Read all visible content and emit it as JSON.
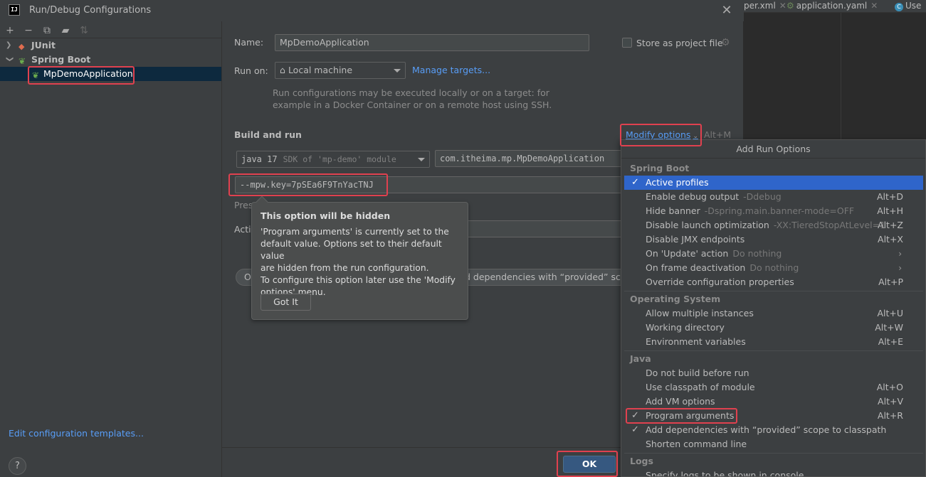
{
  "window": {
    "title": "Run/Debug Configurations",
    "app_icon": "IJ"
  },
  "editor": {
    "tabs": [
      {
        "label": "per.xml"
      },
      {
        "label": "application.yaml"
      },
      {
        "label": "Use"
      }
    ]
  },
  "tree": {
    "items": [
      {
        "label": "JUnit"
      },
      {
        "label": "Spring Boot"
      },
      {
        "label": "MpDemoApplication"
      }
    ]
  },
  "left_footer": {
    "edit_templates": "Edit configuration templates...",
    "help": "?"
  },
  "form": {
    "name_label": "Name:",
    "name_value": "MpDemoApplication",
    "store_label": "Store as project file",
    "run_on_label": "Run on:",
    "run_on_value": "Local machine",
    "manage_targets": "Manage targets...",
    "hint_line1": "Run configurations may be executed locally or on a target: for",
    "hint_line2": "example in a Docker Container or on a remote host using SSH.",
    "build_run": "Build and run",
    "modify_options": "Modify options",
    "modify_shortcut": "Alt+M",
    "jdk_version": "java 17",
    "jdk_hint": "SDK of 'mp-demo' module",
    "main_class": "com.itheima.mp.MpDemoApplication",
    "program_args": "--mpw.key=7pSEa6F9TnYacTNJ",
    "press_partial": "Pres",
    "active_partial": "Activ",
    "chip_o": "O",
    "chip_text": "d dependencies with “provided” scop",
    "ok": "OK"
  },
  "tooltip": {
    "title": "This option will be hidden",
    "line1": "'Program arguments' is currently set to the",
    "line2": "default value. Options set to their default value",
    "line3": "are hidden from the run configuration.",
    "line4": "To configure this option later use the 'Modify",
    "line5": "options' menu.",
    "button": "Got It"
  },
  "popup": {
    "title": "Add Run Options",
    "groups": {
      "spring_boot": "Spring Boot",
      "os": "Operating System",
      "java": "Java",
      "logs": "Logs"
    },
    "spring_boot_items": [
      {
        "name": "Active profiles",
        "hint": "",
        "shortcut": "",
        "checked": true
      },
      {
        "name": "Enable debug output",
        "hint": "-Ddebug",
        "shortcut": "Alt+D"
      },
      {
        "name": "Hide banner",
        "hint": "-Dspring.main.banner-mode=OFF",
        "shortcut": "Alt+H"
      },
      {
        "name": "Disable launch optimization",
        "hint": "-XX:TieredStopAtLevel=1",
        "shortcut": "Alt+Z"
      },
      {
        "name": "Disable JMX endpoints",
        "hint": "",
        "shortcut": "Alt+X"
      },
      {
        "name": "On 'Update' action",
        "hint": "Do nothing",
        "shortcut": "›"
      },
      {
        "name": "On frame deactivation",
        "hint": "Do nothing",
        "shortcut": "›"
      },
      {
        "name": "Override configuration properties",
        "hint": "",
        "shortcut": "Alt+P"
      }
    ],
    "os_items": [
      {
        "name": "Allow multiple instances",
        "shortcut": "Alt+U"
      },
      {
        "name": "Working directory",
        "shortcut": "Alt+W"
      },
      {
        "name": "Environment variables",
        "shortcut": "Alt+E"
      }
    ],
    "java_items": [
      {
        "name": "Do not build before run",
        "shortcut": ""
      },
      {
        "name": "Use classpath of module",
        "shortcut": "Alt+O"
      },
      {
        "name": "Add VM options",
        "shortcut": "Alt+V"
      },
      {
        "name": "Program arguments",
        "shortcut": "Alt+R",
        "checked": true
      },
      {
        "name": "Add dependencies with “provided” scope to classpath",
        "shortcut": "",
        "checked": true
      },
      {
        "name": "Shorten command line",
        "shortcut": ""
      }
    ],
    "logs_items": [
      {
        "name": "Specify logs to be shown in console"
      }
    ],
    "check_glyph": "✓"
  },
  "colors": {
    "highlight_border": "#e0414f",
    "selection": "#2f65ca",
    "link": "#589df6",
    "ok_button": "#365880"
  }
}
